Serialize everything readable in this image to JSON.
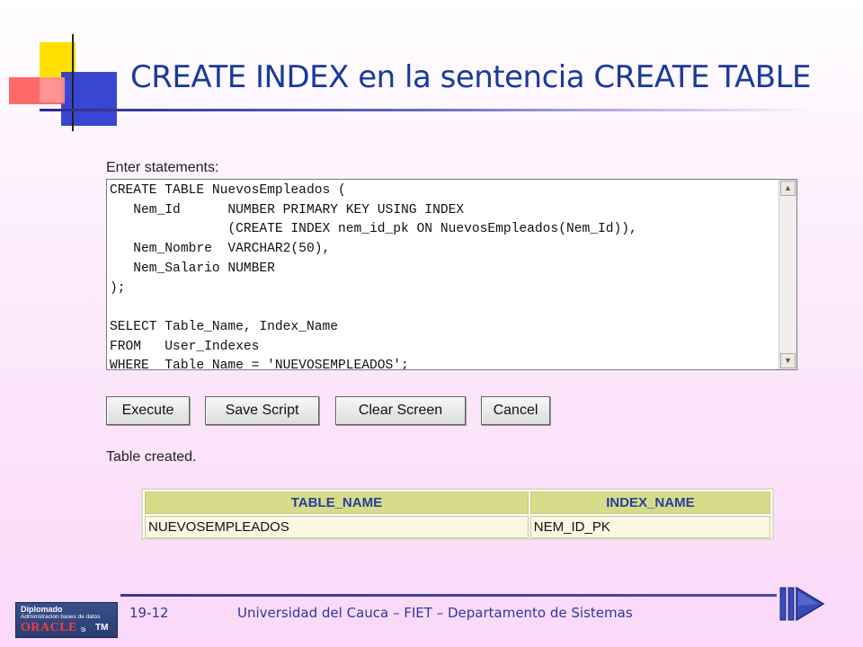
{
  "slide": {
    "title": "CREATE INDEX en la sentencia CREATE TABLE",
    "page_number": "19-12",
    "footer_text": "Universidad del Cauca – FIET – Departamento de Sistemas"
  },
  "editor": {
    "label": "Enter statements:",
    "code": "CREATE TABLE NuevosEmpleados (\n   Nem_Id      NUMBER PRIMARY KEY USING INDEX\n               (CREATE INDEX nem_id_pk ON NuevosEmpleados(Nem_Id)),\n   Nem_Nombre  VARCHAR2(50),\n   Nem_Salario NUMBER\n);\n\nSELECT Table_Name, Index_Name\nFROM   User_Indexes\nWHERE  Table_Name = 'NUEVOSEMPLEADOS';"
  },
  "buttons": {
    "execute": "Execute",
    "save_script": "Save Script",
    "clear_screen": "Clear Screen",
    "cancel": "Cancel"
  },
  "result": {
    "status": "Table created.",
    "columns": [
      "TABLE_NAME",
      "INDEX_NAME"
    ],
    "rows": [
      [
        "NUEVOSEMPLEADOS",
        "NEM_ID_PK"
      ]
    ]
  },
  "badge": {
    "line1": "Diplomado",
    "line2": "Administracion bases de datos",
    "brand": "ORACLE",
    "version": "9i",
    "tm": "TM"
  },
  "colors": {
    "title": "#1a3a9a",
    "header_fill": "#d6dc8a",
    "header_text": "#2a3d9a"
  }
}
